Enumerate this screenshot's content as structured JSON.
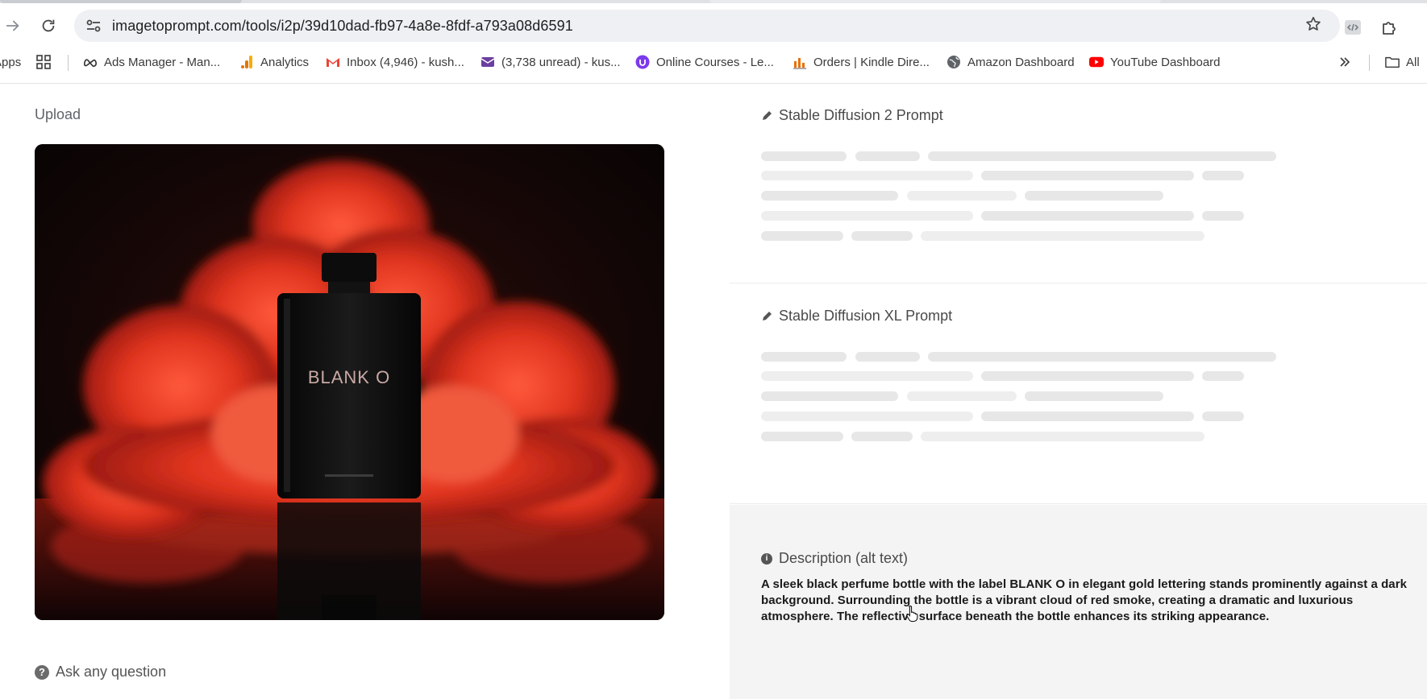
{
  "browser": {
    "url": "imagetoprompt.com/tools/i2p/39d10dad-fb97-4a8e-8fdf-a793a08d6591",
    "bookmarks": [
      {
        "label": "Apps",
        "icon": "apps-grid-icon"
      },
      {
        "label": "Ads Manager - Man...",
        "icon": "meta-icon"
      },
      {
        "label": "Analytics",
        "icon": "analytics-icon"
      },
      {
        "label": "Inbox (4,946) - kush...",
        "icon": "gmail-icon"
      },
      {
        "label": "(3,738 unread) - kus...",
        "icon": "mail-icon"
      },
      {
        "label": "Online Courses - Le...",
        "icon": "udemy-icon"
      },
      {
        "label": "Orders | Kindle Dire...",
        "icon": "kindle-chart-icon"
      },
      {
        "label": "Amazon Dashboard",
        "icon": "globe-icon"
      },
      {
        "label": "YouTube Dashboard",
        "icon": "youtube-icon"
      }
    ],
    "all_bookmarks_label": "All"
  },
  "page": {
    "upload_label": "Upload",
    "image_label_text": "BLANK O",
    "ask_label": "Ask any question",
    "sd2_title": "Stable Diffusion 2 Prompt",
    "sdxl_title": "Stable Diffusion XL Prompt",
    "description_title": "Description (alt text)",
    "description_text": "A sleek black perfume bottle with the label BLANK O in elegant gold lettering stands prominently against a dark background. Surrounding the bottle is a vibrant cloud of red smoke, creating a dramatic and luxurious atmosphere. The reflective surface beneath the bottle enhances its striking appearance."
  },
  "colors": {
    "smoke_red": "#e0341f",
    "bottle_black": "#111111",
    "skeleton_gray": "#e7e7e7",
    "description_bg": "#f4f4f4"
  }
}
